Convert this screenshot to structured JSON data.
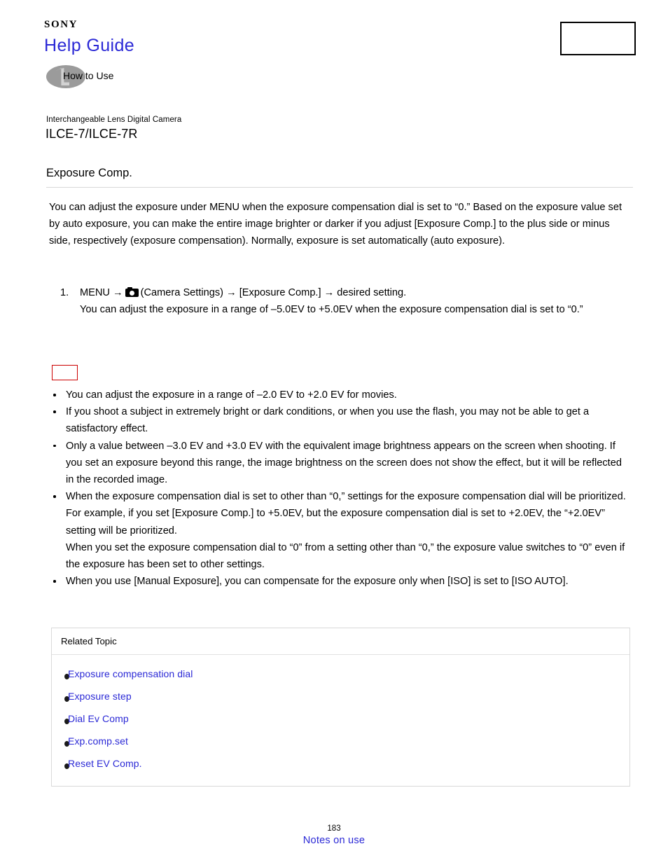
{
  "header": {
    "brand": "SONY",
    "help_guide": "Help Guide",
    "how_to_use": "How to Use",
    "how_to_use_icon": "how-to-use-circle-icon",
    "top_right_box": ""
  },
  "product": {
    "category": "Interchangeable Lens Digital Camera",
    "model": "ILCE-7/ILCE-7R"
  },
  "page": {
    "title": "Exposure Comp.",
    "intro": "You can adjust the exposure under MENU when the exposure compensation dial is set to “0.” Based on the exposure value set by auto exposure, you can make the entire image brighter or darker if you adjust [Exposure Comp.] to the plus side or minus side, respectively (exposure compensation). Normally, exposure is set automatically (auto exposure)."
  },
  "steps": [
    {
      "number": "1.",
      "lead": "MENU →",
      "icon": "camera-settings-icon",
      "trail": "(Camera Settings) → [Exposure Comp.] → desired setting.",
      "detail": "You can adjust the exposure in a range of –5.0EV to +5.0EV when the exposure compensation dial is set to “0.”"
    }
  ],
  "note_label": "",
  "notes": [
    "You can adjust the exposure in a range of –2.0 EV to +2.0 EV for movies.",
    "If you shoot a subject in extremely bright or dark conditions, or when you use the flash, you may not be able to get a satisfactory effect.",
    "Only a value between –3.0 EV and +3.0 EV with the equivalent image brightness appears on the screen when shooting. If you set an exposure beyond this range, the image brightness on the screen does not show the effect, but it will be reflected in the recorded image.",
    "When the exposure compensation dial is set to other than “0,” settings for the exposure compensation dial will be prioritized. For example, if you set [Exposure Comp.] to +5.0EV, but the exposure compensation dial is set to +2.0EV, the “+2.0EV” setting will be prioritized.\nWhen you set the exposure compensation dial to “0” from a setting other than “0,” the exposure value switches to “0” even if the exposure has been set to other settings.",
    "When you use [Manual Exposure], you can compensate for the exposure only when [ISO] is set to [ISO AUTO]."
  ],
  "related": {
    "heading": "Related Topic",
    "links": [
      "Exposure compensation dial",
      "Exposure step",
      "Dial Ev Comp",
      "Exp.comp.set",
      "Reset EV Comp."
    ]
  },
  "footer": {
    "page_number": "183",
    "link": "Notes on use"
  },
  "colors": {
    "link": "#2b29d6",
    "note_border": "#cc0000",
    "icon_gray": "#9b9b9b",
    "rule": "#d8d8d8"
  }
}
